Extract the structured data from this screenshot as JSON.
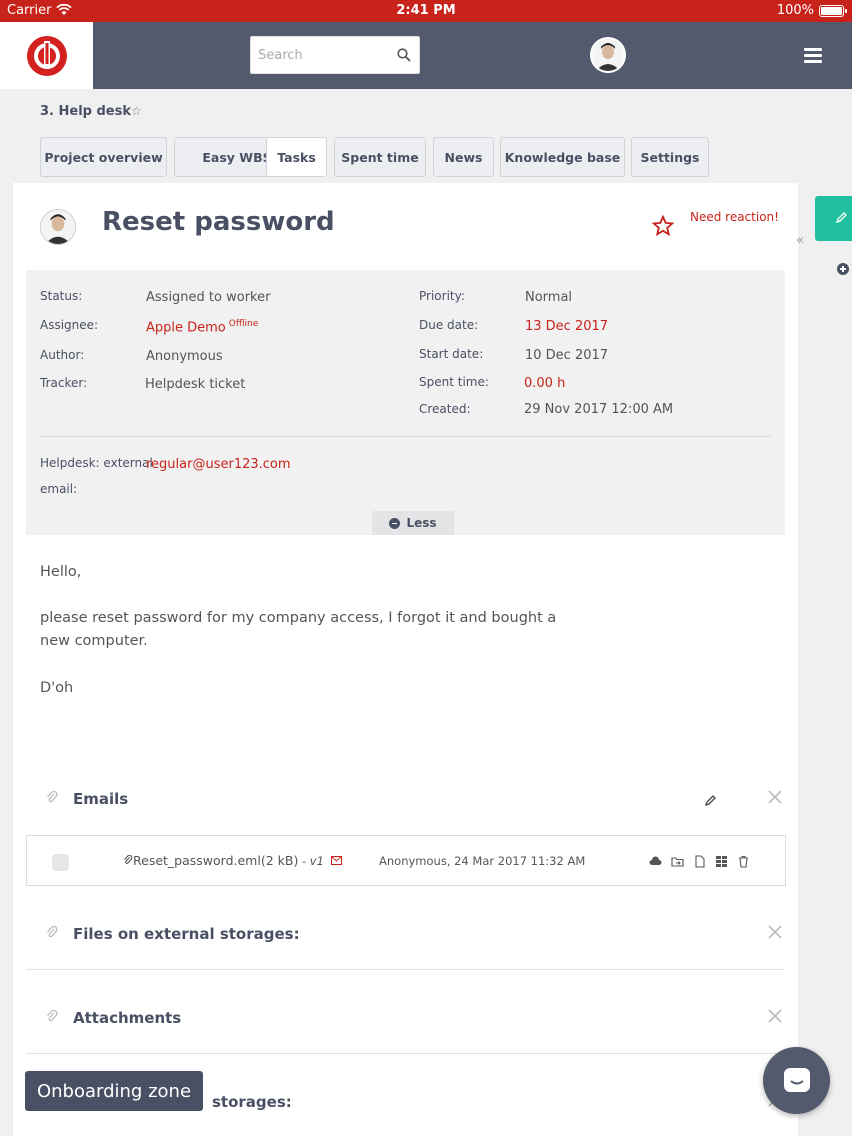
{
  "status_bar": {
    "carrier": "Carrier",
    "time": "2:41 PM",
    "battery": "100%"
  },
  "header": {
    "search_placeholder": "Search"
  },
  "breadcrumb": {
    "text": "3. Help desk",
    "star": "☆"
  },
  "tabs": [
    {
      "label": "Project overview"
    },
    {
      "label": "Easy WBS"
    },
    {
      "label": "Tasks",
      "active": true
    },
    {
      "label": "Spent time"
    },
    {
      "label": "News"
    },
    {
      "label": "Knowledge base"
    },
    {
      "label": "Settings"
    }
  ],
  "issue": {
    "title": "Reset password",
    "reaction": "Need reaction!",
    "collapse": "«",
    "attributes_left": [
      {
        "label": "Status:",
        "value": "Assigned to worker"
      },
      {
        "label": "Assignee:",
        "value": "Apple Demo",
        "badge": "Offline"
      },
      {
        "label": "Author:",
        "value": "Anonymous"
      },
      {
        "label": "Tracker:",
        "value": "Helpdesk ticket"
      }
    ],
    "attributes_right": [
      {
        "label": "Priority:",
        "value": "Normal"
      },
      {
        "label": "Due date:",
        "value": "13 Dec 2017"
      },
      {
        "label": "Start date:",
        "value": "10 Dec 2017"
      },
      {
        "label": "Spent time:",
        "value": "0.00 h"
      },
      {
        "label": "Created:",
        "value": "29 Nov 2017 12:00 AM"
      }
    ],
    "helpdesk_label_1": "Helpdesk: external",
    "helpdesk_label_2": "email:",
    "helpdesk_email": "regular@user123.com",
    "less_label": "Less",
    "description": [
      "Hello,",
      "please reset password for my company access, I forgot it and bought a",
      "new computer.",
      "D'oh"
    ]
  },
  "sections": {
    "emails": "Emails",
    "external": "Files on external storages:",
    "attachments": "Attachments",
    "storages_partial": "storages:"
  },
  "email_row": {
    "filename": "Reset_password.eml",
    "size": "(2 kB)",
    "version": " - v1",
    "meta": "Anonymous, 24 Mar 2017 11:32 AM"
  },
  "onboarding": "Onboarding zone",
  "colors": {
    "accent": "#c8231b",
    "nav": "#535a6e",
    "teal": "#1fbf9f"
  }
}
